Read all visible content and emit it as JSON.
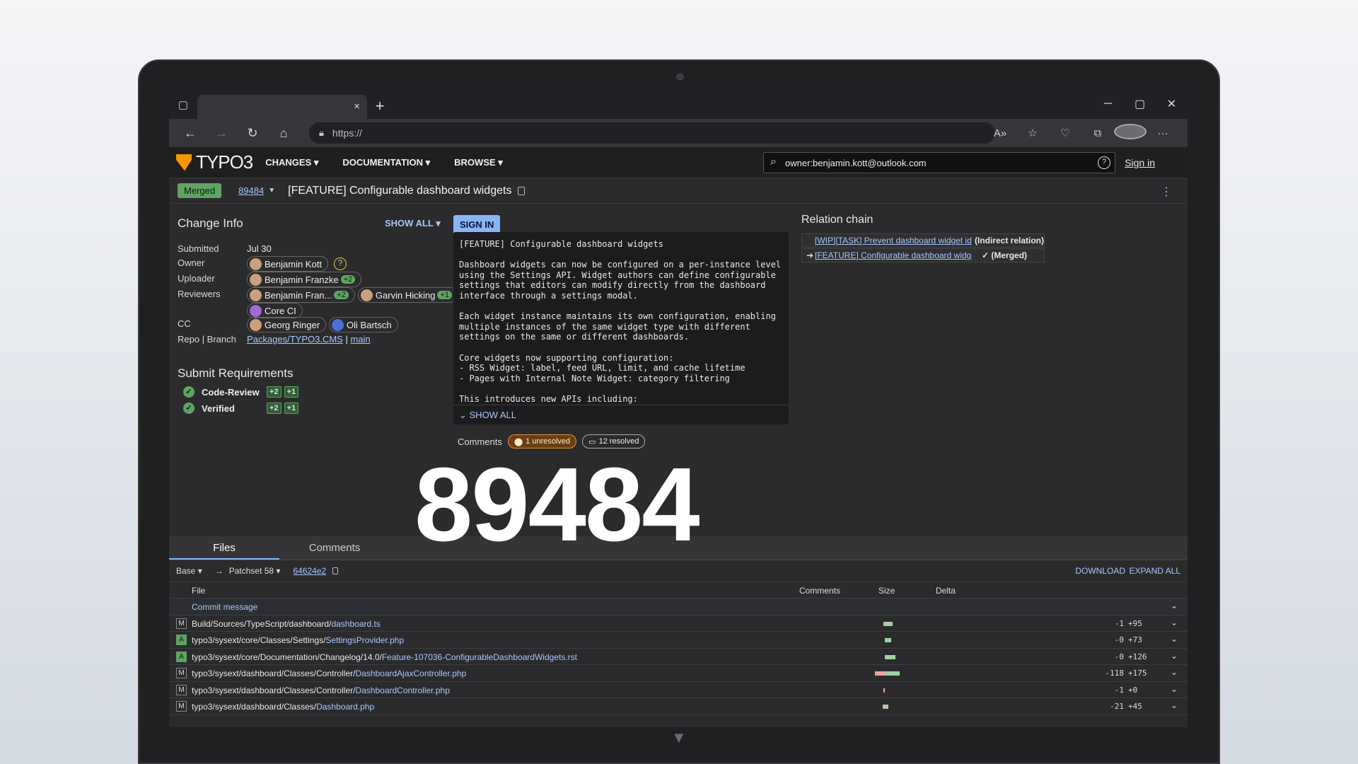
{
  "browser": {
    "url": "https://",
    "tab_close": "×",
    "new_tab": "+"
  },
  "gerrit": {
    "brand": "TYPO3",
    "menus": [
      "CHANGES",
      "DOCUMENTATION",
      "BROWSE"
    ],
    "search_value": "owner:benjamin.kott@outlook.com",
    "sign_in": "Sign in"
  },
  "change": {
    "status": "Merged",
    "number": "89484",
    "title": "[FEATURE] Configurable dashboard widgets"
  },
  "change_info": {
    "heading": "Change Info",
    "show_all": "SHOW ALL",
    "sign_in_button": "SIGN IN",
    "submitted_label": "Submitted",
    "submitted_value": "Jul 30",
    "owner_label": "Owner",
    "owner": "Benjamin Kott",
    "uploader_label": "Uploader",
    "uploader": "Benjamin Franzke",
    "uploader_vote": "+2",
    "reviewers_label": "Reviewers",
    "reviewers": [
      {
        "name": "Benjamin Fran...",
        "vote": "+2"
      },
      {
        "name": "Garvin Hicking",
        "vote": "+1"
      },
      {
        "name": "Core CI",
        "vote": ""
      }
    ],
    "cc_label": "CC",
    "cc": [
      "Georg Ringer",
      "Oli Bartsch"
    ],
    "repo_label": "Repo | Branch",
    "repo": "Packages/TYPO3.CMS",
    "separator": "|",
    "branch": "main"
  },
  "submit_requirements": {
    "heading": "Submit Requirements",
    "items": [
      {
        "label": "Code-Review",
        "votes": [
          "+2",
          "+1"
        ]
      },
      {
        "label": "Verified",
        "votes": [
          "+2",
          "+1"
        ]
      }
    ]
  },
  "commit_message": {
    "text": "[FEATURE] Configurable dashboard widgets\n\nDashboard widgets can now be configured on a per-instance level\nusing the Settings API. Widget authors can define configurable\nsettings that editors can modify directly from the dashboard\ninterface through a settings modal.\n\nEach widget instance maintains its own configuration, enabling\nmultiple instances of the same widget type with different\nsettings on the same or different dashboards.\n\nCore widgets now supporting configuration:\n- RSS Widget: label, feed URL, limit, and cache lifetime\n- Pages with Internal Note Widget: category filtering\n\nThis introduces new APIs including:",
    "show_all": "SHOW ALL"
  },
  "comments_summary": {
    "label": "Comments",
    "unresolved": "1 unresolved",
    "resolved": "12 resolved"
  },
  "relation_chain": {
    "heading": "Relation chain",
    "items": [
      {
        "title": "[WIP][TASK] Prevent dashboard widget identifier",
        "status": "(Indirect relation)",
        "marker": ""
      },
      {
        "title": "[FEATURE] Configurable dashboard widgets",
        "status": "✓ (Merged)",
        "marker": "➔"
      }
    ]
  },
  "file_tabs": [
    "Files",
    "Comments"
  ],
  "files_bar": {
    "base": "Base",
    "arrow": "→",
    "patchset": "Patchset 58",
    "sha": "64624e2",
    "download": "DOWNLOAD",
    "expand_all": "EXPAND ALL"
  },
  "files_table": {
    "headers": {
      "file": "File",
      "comments": "Comments",
      "size": "Size",
      "delta": "Delta"
    },
    "commit_message_row": "Commit message",
    "rows": [
      {
        "status": "M",
        "dir": "Build/Sources/TypeScript/dashboard/",
        "name": "dashboard.ts",
        "del": "-1",
        "ins": "+95",
        "del_n": 1,
        "ins_n": 95
      },
      {
        "status": "A",
        "dir": "typo3/sysext/core/Classes/Settings/",
        "name": "SettingsProvider.php",
        "del": "-0",
        "ins": "+73",
        "del_n": 0,
        "ins_n": 73
      },
      {
        "status": "A",
        "dir": "typo3/sysext/core/Documentation/Changelog/14.0/",
        "name": "Feature-107036-ConfigurableDashboardWidgets.rst",
        "del": "-0",
        "ins": "+126",
        "del_n": 0,
        "ins_n": 126
      },
      {
        "status": "M",
        "dir": "typo3/sysext/dashboard/Classes/Controller/",
        "name": "DashboardAjaxController.php",
        "del": "-118",
        "ins": "+175",
        "del_n": 118,
        "ins_n": 175
      },
      {
        "status": "M",
        "dir": "typo3/sysext/dashboard/Classes/Controller/",
        "name": "DashboardController.php",
        "del": "-1",
        "ins": "+0",
        "del_n": 1,
        "ins_n": 0
      },
      {
        "status": "M",
        "dir": "typo3/sysext/dashboard/Classes/",
        "name": "Dashboard.php",
        "del": "-21",
        "ins": "+45",
        "del_n": 21,
        "ins_n": 45
      }
    ]
  },
  "overlay_number": "89484"
}
